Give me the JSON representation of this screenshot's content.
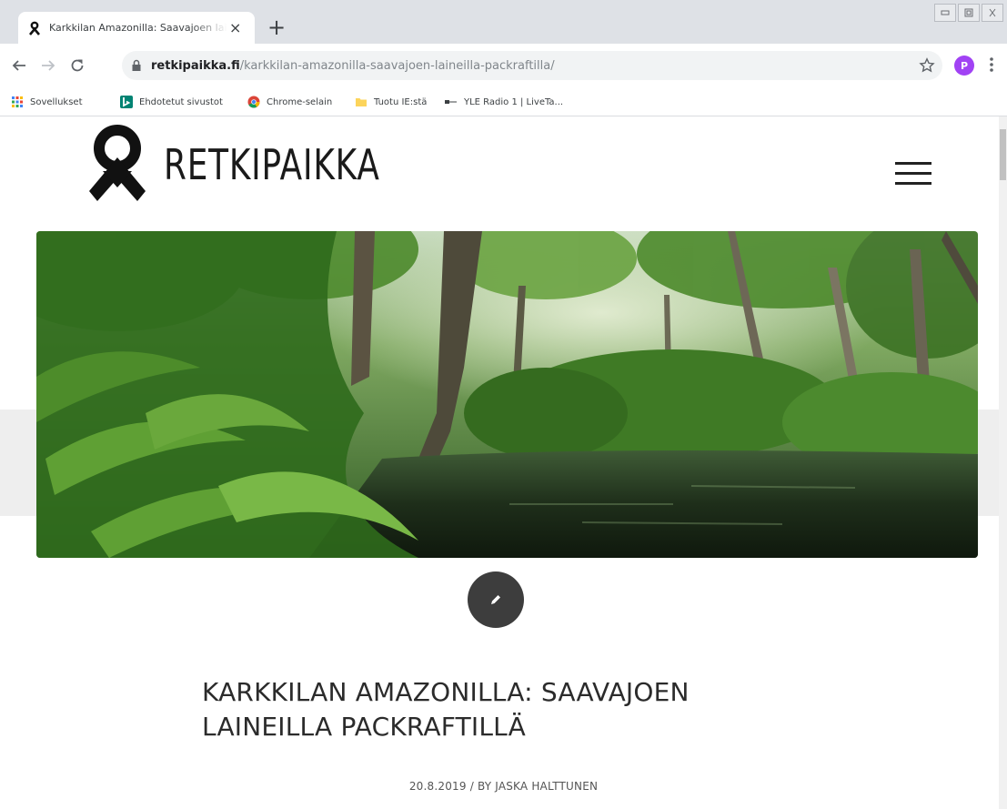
{
  "browser": {
    "tab_title": "Karkkilan Amazonilla: Saavajoen lainei",
    "url_host": "retkipaikka.fi",
    "url_path": "/karkkilan-amazonilla-saavajoen-laineilla-packraftilla/",
    "profile_initial": "P",
    "bookmarks": [
      {
        "label": "Sovellukset",
        "icon": "apps-grid-icon"
      },
      {
        "label": "Ehdotetut sivustot",
        "icon": "bing-icon"
      },
      {
        "label": "Chrome-selain",
        "icon": "chrome-icon"
      },
      {
        "label": "Tuotu IE:stä",
        "icon": "folder-icon"
      },
      {
        "label": "YLE Radio 1 | LiveTa...",
        "icon": "radio-icon"
      }
    ]
  },
  "site": {
    "logo_text": "RETKIPAIKKA"
  },
  "post": {
    "title_line1": "KARKKILAN AMAZONILLA: SAAVAJOEN",
    "title_line2": "LAINEILLA PACKRAFTILLÄ",
    "meta": "20.8.2019 / BY JASKA HALTTUNEN"
  },
  "colors": {
    "chrome_bg": "#dee1e6",
    "omnibox_bg": "#f1f3f4",
    "profile": "#a142f4",
    "post_icon_bg": "#3d3d3d",
    "title_text": "#2b2b2b"
  }
}
